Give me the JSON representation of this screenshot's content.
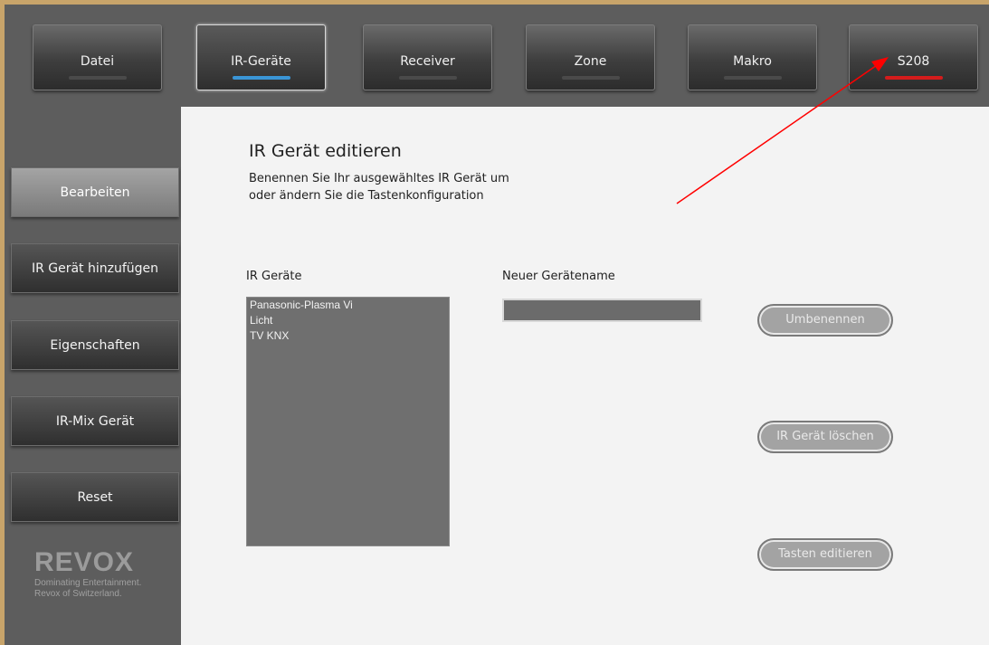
{
  "nav": {
    "tabs": [
      {
        "label": "Datei"
      },
      {
        "label": "IR-Geräte"
      },
      {
        "label": "Receiver"
      },
      {
        "label": "Zone"
      },
      {
        "label": "Makro"
      },
      {
        "label": "S208"
      }
    ],
    "active_tab": "IR-Geräte",
    "indicator_colors": {
      "active": "#3a95d6",
      "alert": "#d41c1c"
    }
  },
  "sidebar": {
    "items": [
      {
        "label": "Bearbeiten"
      },
      {
        "label": "IR Gerät hinzufügen"
      },
      {
        "label": "Eigenschaften"
      },
      {
        "label": "IR-Mix Gerät"
      },
      {
        "label": "Reset"
      }
    ],
    "active_item": "Bearbeiten"
  },
  "logo": {
    "wordmark": "REVOX",
    "tagline_1": "Dominating Entertainment.",
    "tagline_2": "Revox of Switzerland."
  },
  "main": {
    "title": "IR Gerät editieren",
    "description_1": "Benennen Sie Ihr ausgewähltes IR Gerät um",
    "description_2": "oder ändern Sie die Tastenkonfiguration",
    "list_label": "IR Geräte",
    "devices": [
      "Panasonic-Plasma Vi",
      "Licht",
      "TV KNX"
    ],
    "name_label": "Neuer Gerätename",
    "name_value": "",
    "rename_button": "Umbenennen",
    "delete_button": "IR Gerät löschen",
    "edit_keys_button": "Tasten editieren"
  },
  "annotation": {
    "arrow_color": "#ff0000"
  }
}
